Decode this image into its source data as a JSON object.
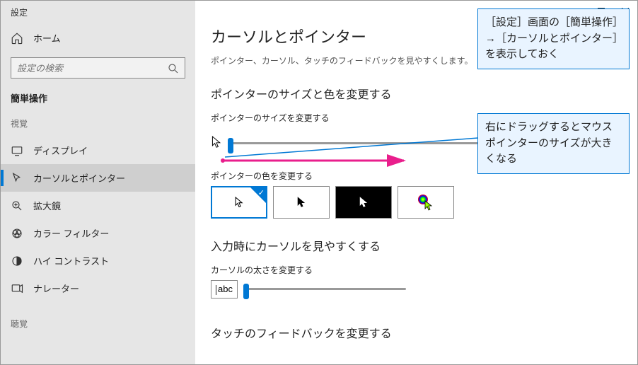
{
  "app": {
    "title": "設定"
  },
  "sidebar": {
    "home": "ホーム",
    "search_placeholder": "設定の検索",
    "category": "簡単操作",
    "groups": {
      "vision": "視覚",
      "hearing": "聴覚"
    },
    "items": [
      {
        "label": "ディスプレイ"
      },
      {
        "label": "カーソルとポインター"
      },
      {
        "label": "拡大鏡"
      },
      {
        "label": "カラー フィルター"
      },
      {
        "label": "ハイ コントラスト"
      },
      {
        "label": "ナレーター"
      }
    ]
  },
  "main": {
    "title": "カーソルとポインター",
    "subtitle": "ポインター、カーソル、タッチのフィードバックを見やすくします。",
    "section_pointer": "ポインターのサイズと色を変更する",
    "label_size": "ポインターのサイズを変更する",
    "label_color": "ポインターの色を変更する",
    "section_cursor": "入力時にカーソルを見やすくする",
    "label_thickness": "カーソルの太さを変更する",
    "preview_text": "abc",
    "section_touch": "タッチのフィードバックを変更する"
  },
  "callouts": {
    "c1": "［設定］画面の［簡単操作］→［カーソルとポインター］を表示しておく",
    "c2": "右にドラッグするとマウスポインターのサイズが大きくなる"
  }
}
